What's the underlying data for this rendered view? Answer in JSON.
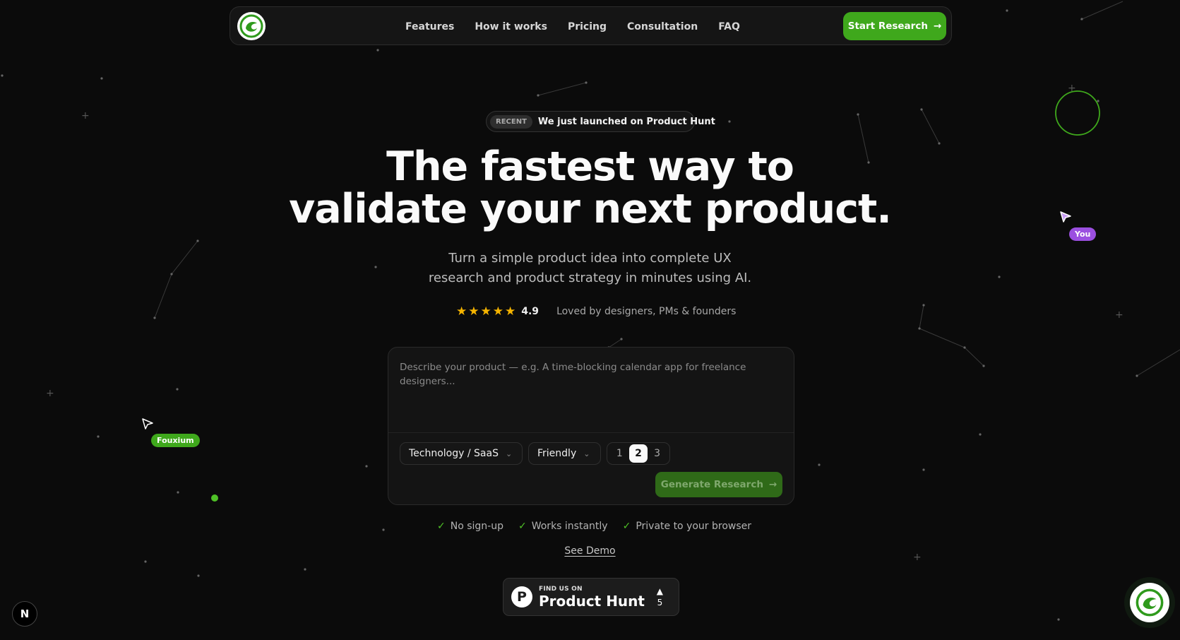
{
  "nav": {
    "links": [
      "Features",
      "How it works",
      "Pricing",
      "Consultation",
      "FAQ"
    ],
    "cta_label": "Start Research"
  },
  "badge": {
    "tag": "RECENT",
    "text": "We just launched on Product Hunt"
  },
  "hero": {
    "title_line1": "The fastest way to",
    "title_line2": "validate your next product.",
    "subtitle_line1": "Turn a simple product idea into complete UX",
    "subtitle_line2": "research and product strategy in minutes using AI."
  },
  "rating": {
    "stars": 5,
    "score": "4.9",
    "text": "Loved by designers, PMs & founders"
  },
  "form": {
    "placeholder": "Describe your product — e.g. A time-blocking calendar app for freelance designers...",
    "industry": "Technology / SaaS",
    "tone": "Friendly",
    "depth_options": [
      "1",
      "2",
      "3"
    ],
    "depth_selected": "2",
    "generate_label": "Generate Research"
  },
  "checks": [
    "No sign-up",
    "Works instantly",
    "Private to your browser"
  ],
  "demo_link": "See Demo",
  "product_hunt": {
    "small": "FIND US ON",
    "big": "Product Hunt",
    "votes": "5"
  },
  "cursors": {
    "other_user": "Fouxium",
    "self": "You"
  },
  "colors": {
    "accent": "#3fa81c",
    "self_tag": "#9b4fe0",
    "star": "#f5b400"
  }
}
